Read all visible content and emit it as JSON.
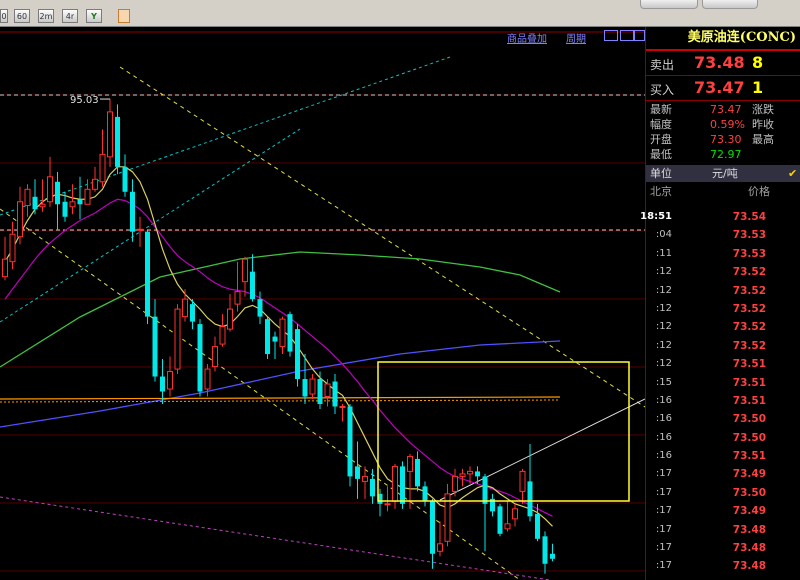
{
  "toolbar": {
    "buttons": [
      "0",
      "60",
      "2m",
      "4r",
      "Y"
    ]
  },
  "chart_links": {
    "overlay": "商品叠加",
    "period": "周期"
  },
  "chart_data": {
    "type": "candlestick",
    "title": "",
    "high_label": "95.03",
    "y_range": [
      56.5,
      100
    ],
    "candles": [
      {
        "o": 80.8,
        "c": 82.2,
        "h": 84,
        "l": 80.5
      },
      {
        "o": 82.0,
        "c": 84.2,
        "h": 85.2,
        "l": 81.4
      },
      {
        "o": 84.0,
        "c": 86.8,
        "h": 88,
        "l": 83.4
      },
      {
        "o": 86.5,
        "c": 87.8,
        "h": 88.2,
        "l": 85.6
      },
      {
        "o": 87.2,
        "c": 86.2,
        "h": 88.6,
        "l": 85.8
      },
      {
        "o": 86.4,
        "c": 86.6,
        "h": 88.6,
        "l": 86.0
      },
      {
        "o": 86.8,
        "c": 88.8,
        "h": 90.4,
        "l": 86.4
      },
      {
        "o": 88.4,
        "c": 86.6,
        "h": 89.2,
        "l": 84.6
      },
      {
        "o": 86.8,
        "c": 85.6,
        "h": 87.6,
        "l": 85.2
      },
      {
        "o": 86.4,
        "c": 86.8,
        "h": 88.2,
        "l": 85.8
      },
      {
        "o": 87.0,
        "c": 86.6,
        "h": 88.8,
        "l": 85.4
      },
      {
        "o": 86.6,
        "c": 87.8,
        "h": 88.6,
        "l": 86.6
      },
      {
        "o": 87.8,
        "c": 88.6,
        "h": 89.6,
        "l": 87.6
      },
      {
        "o": 88.4,
        "c": 90.6,
        "h": 92.6,
        "l": 88.0
      },
      {
        "o": 90.4,
        "c": 94.0,
        "h": 95.03,
        "l": 89.6
      },
      {
        "o": 93.6,
        "c": 89.6,
        "h": 94.6,
        "l": 89.0
      },
      {
        "o": 89.6,
        "c": 87.6,
        "h": 90.6,
        "l": 87.2
      },
      {
        "o": 87.6,
        "c": 84.4,
        "h": 88.6,
        "l": 83.6
      },
      {
        "o": 84.6,
        "c": 84.6,
        "h": 85.6,
        "l": 83.2
      },
      {
        "o": 84.4,
        "c": 77.6,
        "h": 84.6,
        "l": 77.0
      },
      {
        "o": 77.6,
        "c": 72.8,
        "h": 79.0,
        "l": 72.4
      },
      {
        "o": 72.8,
        "c": 71.6,
        "h": 74.2,
        "l": 70.6
      },
      {
        "o": 71.8,
        "c": 73.2,
        "h": 74.4,
        "l": 71.2
      },
      {
        "o": 73.4,
        "c": 78.2,
        "h": 78.6,
        "l": 73.0
      },
      {
        "o": 77.6,
        "c": 79.0,
        "h": 79.8,
        "l": 77.2
      },
      {
        "o": 78.6,
        "c": 77.2,
        "h": 79.0,
        "l": 76.6
      },
      {
        "o": 77.0,
        "c": 71.6,
        "h": 77.4,
        "l": 71.2
      },
      {
        "o": 71.8,
        "c": 73.4,
        "h": 73.8,
        "l": 71.2
      },
      {
        "o": 73.6,
        "c": 75.2,
        "h": 76.0,
        "l": 73.2
      },
      {
        "o": 75.4,
        "c": 76.8,
        "h": 77.8,
        "l": 75.2
      },
      {
        "o": 76.6,
        "c": 78.2,
        "h": 79.4,
        "l": 76.4
      },
      {
        "o": 78.6,
        "c": 79.6,
        "h": 82.0,
        "l": 78.0
      },
      {
        "o": 80.4,
        "c": 82.2,
        "h": 82.4,
        "l": 79.2
      },
      {
        "o": 81.2,
        "c": 79.0,
        "h": 82.6,
        "l": 78.8
      },
      {
        "o": 79.0,
        "c": 77.6,
        "h": 79.6,
        "l": 77.0
      },
      {
        "o": 77.4,
        "c": 74.6,
        "h": 77.6,
        "l": 74.2
      },
      {
        "o": 76.0,
        "c": 75.6,
        "h": 76.4,
        "l": 74.2
      },
      {
        "o": 75.2,
        "c": 77.4,
        "h": 77.6,
        "l": 74.6
      },
      {
        "o": 77.8,
        "c": 74.8,
        "h": 78.0,
        "l": 74.4
      },
      {
        "o": 76.6,
        "c": 72.6,
        "h": 77.0,
        "l": 72.0
      },
      {
        "o": 72.6,
        "c": 71.2,
        "h": 74.6,
        "l": 70.6
      },
      {
        "o": 71.4,
        "c": 72.6,
        "h": 73.0,
        "l": 71.0
      },
      {
        "o": 72.6,
        "c": 70.6,
        "h": 73.2,
        "l": 70.2
      },
      {
        "o": 71.2,
        "c": 72.2,
        "h": 72.6,
        "l": 70.4
      },
      {
        "o": 72.4,
        "c": 70.4,
        "h": 73.0,
        "l": 69.8
      },
      {
        "o": 70.4,
        "c": 70.4,
        "h": 70.6,
        "l": 69.2
      },
      {
        "o": 70.4,
        "c": 64.8,
        "h": 70.6,
        "l": 64.0
      },
      {
        "o": 65.6,
        "c": 64.6,
        "h": 67.6,
        "l": 63.0
      },
      {
        "o": 64.4,
        "c": 64.8,
        "h": 65.6,
        "l": 63.0
      },
      {
        "o": 64.6,
        "c": 63.2,
        "h": 65.4,
        "l": 62.6
      },
      {
        "o": 63.4,
        "c": 62.6,
        "h": 63.8,
        "l": 61.6
      },
      {
        "o": 62.6,
        "c": 62.6,
        "h": 64.0,
        "l": 62.0
      },
      {
        "o": 62.8,
        "c": 65.6,
        "h": 65.8,
        "l": 62.2
      },
      {
        "o": 65.6,
        "c": 62.6,
        "h": 66.0,
        "l": 62.2
      },
      {
        "o": 65.2,
        "c": 66.4,
        "h": 66.6,
        "l": 62.2
      },
      {
        "o": 66.2,
        "c": 64.0,
        "h": 66.8,
        "l": 63.6
      },
      {
        "o": 64.0,
        "c": 62.8,
        "h": 64.4,
        "l": 62.4
      },
      {
        "o": 62.8,
        "c": 58.6,
        "h": 63.0,
        "l": 57.4
      },
      {
        "o": 58.8,
        "c": 59.4,
        "h": 61.2,
        "l": 58.4
      },
      {
        "o": 59.6,
        "c": 63.4,
        "h": 64.2,
        "l": 59.2
      },
      {
        "o": 63.6,
        "c": 64.8,
        "h": 65.4,
        "l": 63.2
      },
      {
        "o": 64.8,
        "c": 65.0,
        "h": 65.4,
        "l": 64.0
      },
      {
        "o": 65.0,
        "c": 65.2,
        "h": 65.6,
        "l": 64.2
      },
      {
        "o": 65.2,
        "c": 64.8,
        "h": 65.6,
        "l": 64.2
      },
      {
        "o": 64.8,
        "c": 62.6,
        "h": 65.0,
        "l": 58.8
      },
      {
        "o": 63.0,
        "c": 62.0,
        "h": 63.4,
        "l": 61.6
      },
      {
        "o": 62.4,
        "c": 60.2,
        "h": 62.6,
        "l": 60.0
      },
      {
        "o": 60.6,
        "c": 61.0,
        "h": 62.8,
        "l": 60.4
      },
      {
        "o": 61.4,
        "c": 62.2,
        "h": 62.6,
        "l": 60.8
      },
      {
        "o": 63.6,
        "c": 65.2,
        "h": 65.4,
        "l": 62.6
      },
      {
        "o": 64.4,
        "c": 61.6,
        "h": 67.4,
        "l": 61.2
      },
      {
        "o": 61.8,
        "c": 59.8,
        "h": 62.6,
        "l": 59.6
      },
      {
        "o": 60.0,
        "c": 57.8,
        "h": 60.4,
        "l": 57.0
      },
      {
        "o": 58.6,
        "c": 58.2,
        "h": 59.4,
        "l": 58.0
      }
    ],
    "ma_lines": {
      "ma1": [
        82,
        83,
        84.2,
        85.3,
        86.2,
        86.8,
        87.2,
        87.4,
        87.3,
        87.1,
        87,
        87,
        87.2,
        87.8,
        89,
        89.6,
        89.6,
        89.2,
        88.4,
        87,
        85,
        83,
        81.4,
        80.2,
        79.4,
        78.8,
        78.2,
        77.5,
        77,
        76.8,
        77,
        77.6,
        78.3,
        78.5,
        78.2,
        77.6,
        77,
        76.5,
        76,
        75.2,
        74.3,
        73.4,
        72.7,
        72.2,
        71.7,
        71.3,
        70.3,
        69.1,
        67.9,
        66.7,
        65.5,
        64.6,
        64.2,
        63.9,
        63.8,
        63.8,
        63.6,
        63.1,
        62.5,
        62.3,
        62.6,
        63.1,
        63.5,
        63.9,
        64.1,
        63.9,
        63.4,
        63,
        62.6,
        62.4,
        62.2,
        61.9,
        61.4,
        60.8
      ],
      "ma2": [
        79,
        79.8,
        80.6,
        81.4,
        82.2,
        82.9,
        83.5,
        84,
        84.5,
        84.9,
        85.3,
        85.6,
        85.9,
        86.3,
        86.7,
        87,
        86.9,
        86.6,
        86.2,
        85.6,
        84.8,
        84,
        83.2,
        82.5,
        82,
        81.6,
        81.2,
        80.7,
        80.3,
        80,
        79.8,
        79.7,
        79.6,
        79.4,
        79.1,
        78.7,
        78.3,
        77.9,
        77.5,
        77,
        76.5,
        76,
        75.5,
        75,
        74.4,
        73.8,
        73.1,
        72.4,
        71.6,
        70.9,
        70.1,
        69.4,
        68.7,
        68.1,
        67.5,
        67,
        66.5,
        66,
        65.5,
        65.1,
        64.8,
        64.6,
        64.4,
        64.2,
        64,
        63.8,
        63.6,
        63.4,
        63.1,
        62.8,
        62.5,
        62.2,
        61.9,
        61.6
      ]
    }
  },
  "panel": {
    "title": "美原油连(CONC)",
    "sell_label": "卖出",
    "sell_price": "73.48",
    "sell_vol": "8",
    "buy_label": "买入",
    "buy_price": "73.47",
    "buy_vol": "1",
    "stats": {
      "latest_label": "最新",
      "latest": "73.47",
      "change_label": "涨跌",
      "range_label": "幅度",
      "range": "0.59%",
      "prevclose_label": "昨收",
      "open_label": "开盘",
      "open": "73.30",
      "high_label": "最高",
      "low_label": "最低",
      "low": "72.97"
    },
    "unit_label": "单位",
    "unit_value": "元/吨",
    "city_label": "北京",
    "price_header": "价格",
    "ticks": [
      {
        "t": "18:51",
        "p": "73.54"
      },
      {
        "t": ":04",
        "p": "73.53"
      },
      {
        "t": ":11",
        "p": "73.53"
      },
      {
        "t": ":12",
        "p": "73.52"
      },
      {
        "t": ":12",
        "p": "73.52"
      },
      {
        "t": ":12",
        "p": "73.52"
      },
      {
        "t": ":12",
        "p": "73.52"
      },
      {
        "t": ":12",
        "p": "73.52"
      },
      {
        "t": ":12",
        "p": "73.51"
      },
      {
        "t": ":15",
        "p": "73.51"
      },
      {
        "t": ":16",
        "p": "73.51"
      },
      {
        "t": ":16",
        "p": "73.50"
      },
      {
        "t": ":16",
        "p": "73.50"
      },
      {
        "t": ":16",
        "p": "73.51"
      },
      {
        "t": ":17",
        "p": "73.49"
      },
      {
        "t": ":17",
        "p": "73.50"
      },
      {
        "t": ":17",
        "p": "73.49"
      },
      {
        "t": ":17",
        "p": "73.48"
      },
      {
        "t": ":17",
        "p": "73.48"
      },
      {
        "t": ":17",
        "p": "73.48"
      }
    ]
  }
}
